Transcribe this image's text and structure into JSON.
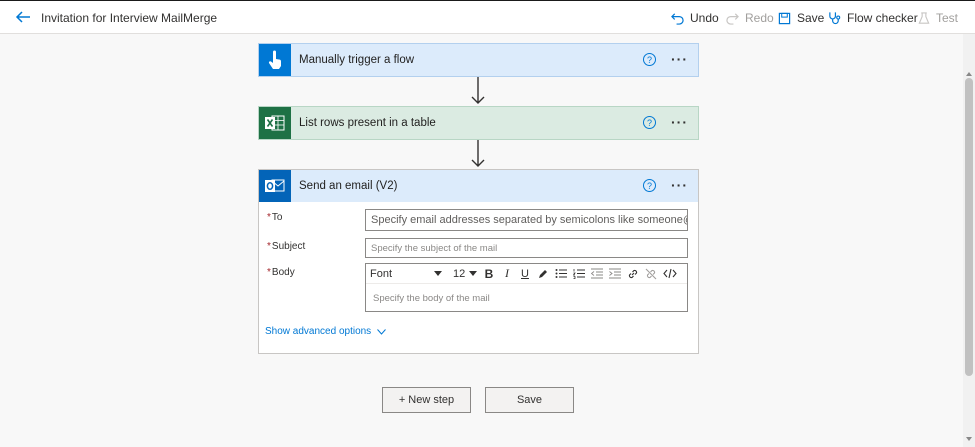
{
  "header": {
    "title": "Invitation for Interview MailMerge",
    "commands": {
      "undo": "Undo",
      "redo": "Redo",
      "save": "Save",
      "flow_checker": "Flow checker",
      "test": "Test"
    }
  },
  "steps": [
    {
      "title": "Manually trigger a flow",
      "color": "#0078d4",
      "header_bg": "#dcebfb",
      "icon": "touch-hand-icon"
    },
    {
      "title": "List rows present in a table",
      "color": "#1e7145",
      "header_bg": "#dbebe2",
      "icon": "excel-icon"
    },
    {
      "title": "Send an email (V2)",
      "color": "#0364b8",
      "header_bg": "#dcebfb",
      "icon": "outlook-icon"
    }
  ],
  "common": {
    "help": "?",
    "more": "···"
  },
  "email_form": {
    "to_label": "To",
    "to_placeholder": "Specify email addresses separated by semicolons like someone@cont",
    "subject_label": "Subject",
    "subject_placeholder": "Specify the subject of the mail",
    "body_label": "Body",
    "font_label": "Font",
    "font_size": "12",
    "body_placeholder": "Specify the body of the mail",
    "required_mark": "*",
    "advanced": "Show advanced options"
  },
  "footer": {
    "new_step": "+ New step",
    "save": "Save"
  }
}
